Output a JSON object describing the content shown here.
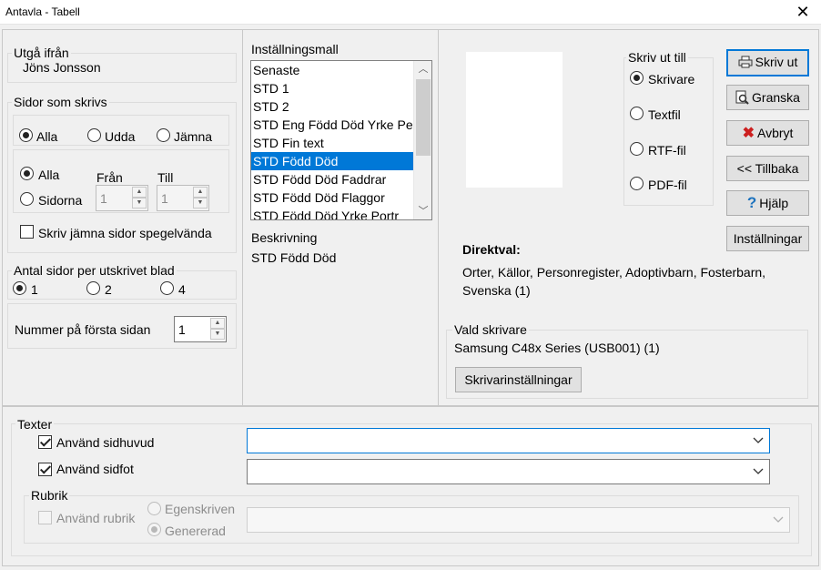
{
  "window": {
    "title": "Antavla - Tabell",
    "close_glyph": "✕"
  },
  "utgang": {
    "label": "Utgå ifrån",
    "name": "Jöns Jonsson"
  },
  "sidor": {
    "label": "Sidor som skrivs",
    "filter": [
      "Alla",
      "Udda",
      "Jämna"
    ],
    "range_all": "Alla",
    "range_pages": "Sidorna",
    "from_label": "Från",
    "to_label": "Till",
    "from_value": "1",
    "to_value": "1",
    "mirror_label": "Skriv jämna sidor spegelvända"
  },
  "antal": {
    "label": "Antal sidor per utskrivet blad",
    "options": [
      "1",
      "2",
      "4"
    ]
  },
  "nummer": {
    "label": "Nummer på första sidan",
    "value": "1"
  },
  "mall": {
    "label": "Inställningsmall",
    "items": [
      "Senaste",
      "STD 1",
      "STD 2",
      "STD Eng Född Död Yrke Pe",
      "STD Fin text",
      "STD Född Död",
      "STD Född Död Faddrar",
      "STD Född Död Flaggor",
      "STD Född Död Yrke Portr"
    ],
    "selected_index": 5,
    "desc_label": "Beskrivning",
    "desc_value": "STD Född Död"
  },
  "output": {
    "label": "Skriv ut till",
    "options": [
      "Skrivare",
      "Textfil",
      "RTF-fil",
      "PDF-fil"
    ]
  },
  "buttons": {
    "print": "Skriv ut",
    "preview": "Granska",
    "cancel": "Avbryt",
    "back": "<< Tillbaka",
    "help": "Hjälp",
    "settings": "Inställningar"
  },
  "direktval": {
    "label": "Direktval:",
    "text": "Orter, Källor, Personregister, Adoptivbarn, Fosterbarn, Svenska (1)"
  },
  "printer": {
    "label": "Vald skrivare",
    "name": "Samsung C48x Series (USB001) (1)",
    "settings_button": "Skrivarinställningar"
  },
  "texter": {
    "label": "Texter",
    "header_label": "Använd sidhuvud",
    "footer_label": "Använd sidfot",
    "rubrik_label": "Rubrik",
    "use_rubrik": "Använd rubrik",
    "egenskriven": "Egenskriven",
    "genererad": "Genererad"
  },
  "colors": {
    "accent": "#0078d7",
    "cancel_icon": "#cc1f1f",
    "help_icon": "#1e73be"
  }
}
